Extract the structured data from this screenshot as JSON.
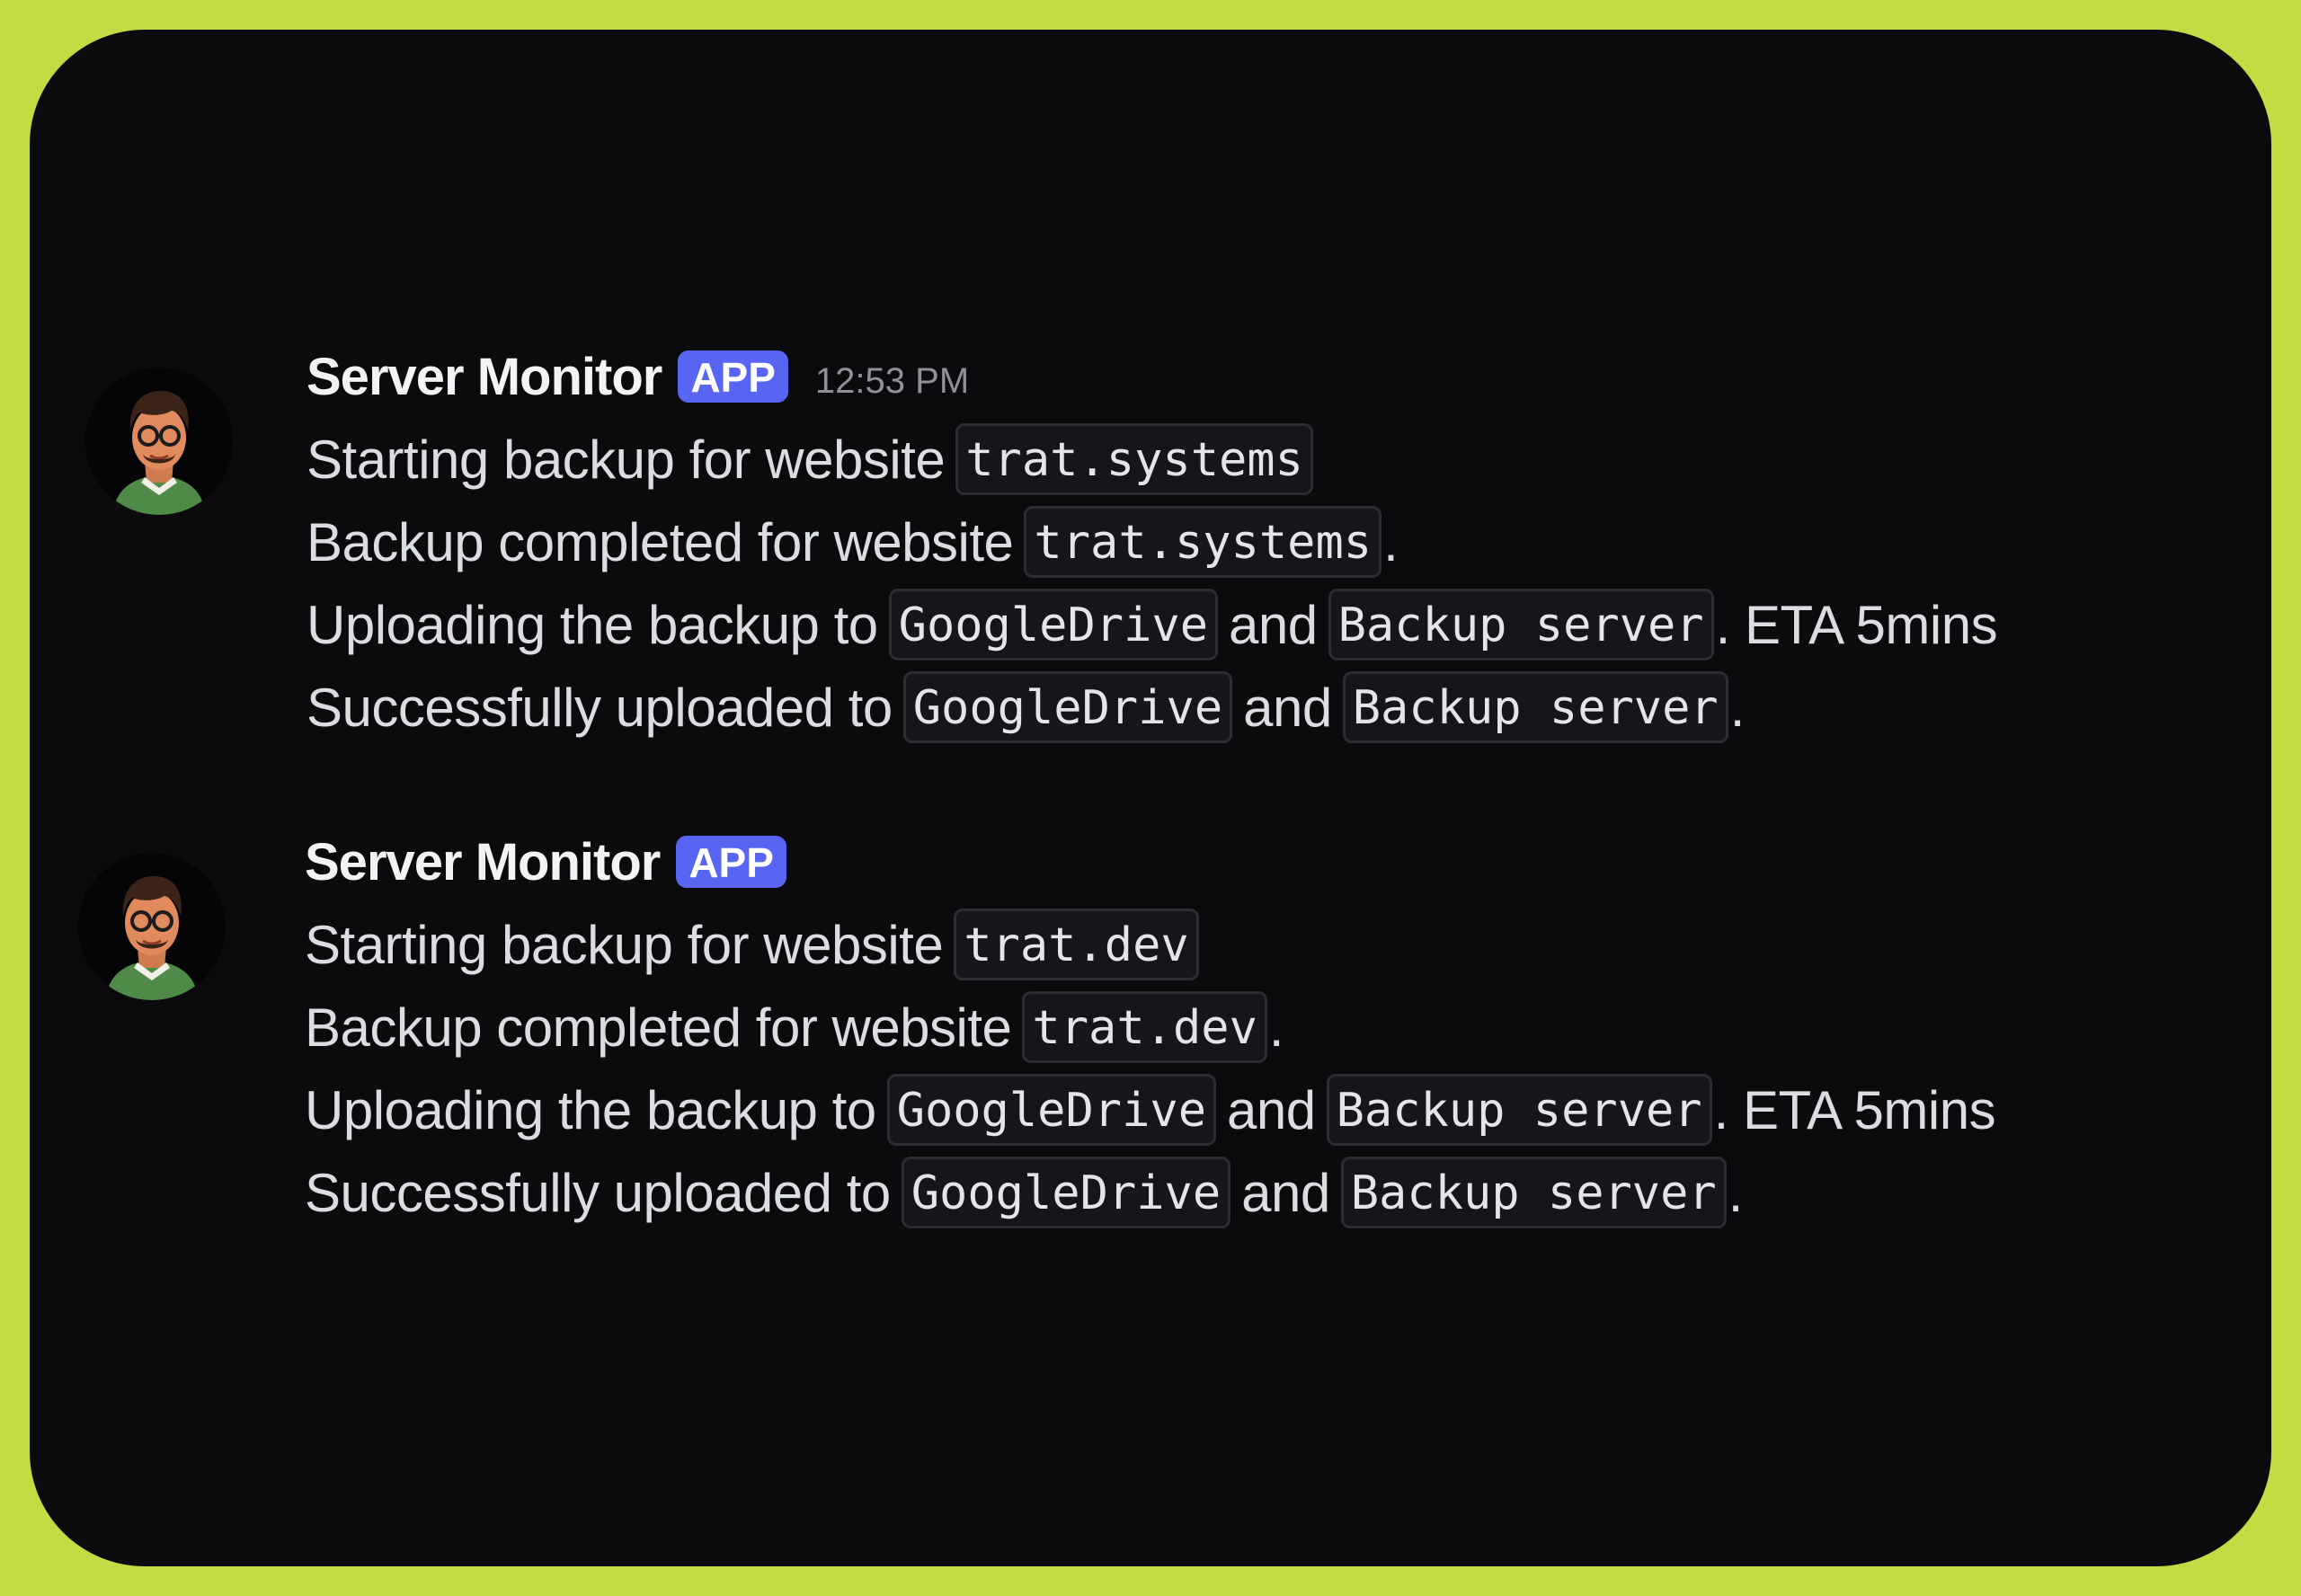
{
  "messages": [
    {
      "author": "Server Monitor",
      "badge": "APP",
      "timestamp": "12:53 PM",
      "lines": [
        {
          "text": "Starting backup for website",
          "code": "trat.systems",
          "suffix": ""
        },
        {
          "text": "Backup completed for website",
          "code": "trat.systems",
          "suffix": "."
        },
        {
          "text": "Uploading the backup to",
          "code1": "GoogleDrive",
          "mid": "and",
          "code2": "Backup server",
          "suffix": ". ETA 5mins"
        },
        {
          "text": "Successfully uploaded to",
          "code1": "GoogleDrive",
          "mid": "and",
          "code2": "Backup server",
          "suffix": "."
        }
      ]
    },
    {
      "author": "Server Monitor",
      "badge": "APP",
      "lines": [
        {
          "text": "Starting backup for website",
          "code": "trat.dev",
          "suffix": ""
        },
        {
          "text": "Backup completed for website",
          "code": "trat.dev",
          "suffix": "."
        },
        {
          "text": "Uploading the backup to",
          "code1": "GoogleDrive",
          "mid": "and",
          "code2": "Backup server",
          "suffix": ". ETA 5mins"
        },
        {
          "text": "Successfully uploaded to",
          "code1": "GoogleDrive",
          "mid": "and",
          "code2": "Backup server",
          "suffix": "."
        }
      ]
    }
  ],
  "colors": {
    "frame": "#c5db44",
    "background": "#0b0b0e",
    "badge": "#5865f2",
    "text": "#dbdee1"
  },
  "icons": {
    "avatar": "avatar-icon"
  }
}
